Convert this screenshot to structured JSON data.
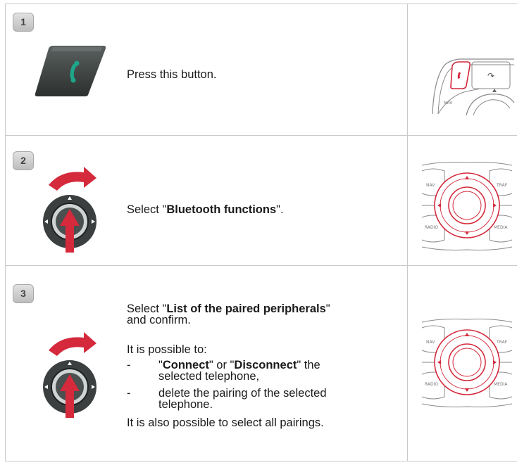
{
  "steps": [
    {
      "number": "1",
      "button_icon": "phone-handset-icon",
      "instruction": "Press this button.",
      "panel_labels": {
        "nav": "NAV"
      }
    },
    {
      "number": "2",
      "button_icon": "rotary-dial-icon",
      "instruction_prefix": "Select \"",
      "instruction_bold": "Bluetooth functions",
      "instruction_suffix": "\".",
      "panel_labels": {
        "nav": "NAV",
        "traf": "TRAF",
        "radio": "RADIO",
        "media": "MEDIA"
      }
    },
    {
      "number": "3",
      "button_icon": "rotary-dial-icon",
      "select_prefix": "Select \"",
      "select_bold": "List of the paired peripherals",
      "select_suffix": "\"",
      "select_line2": "and confirm.",
      "possible_intro": "It is possible to:",
      "bullets": [
        {
          "dash": "-",
          "q1": "\"",
          "bold1": "Connect",
          "mid": "\" or \"",
          "bold2": "Disconnect",
          "end": "\" the",
          "line2": "selected telephone,"
        },
        {
          "dash": "-",
          "line1": "delete the pairing of the selected",
          "line2": "telephone."
        }
      ],
      "also_possible": "It is also possible to select all pairings.",
      "panel_labels": {
        "nav": "NAV",
        "traf": "TRAF",
        "radio": "RADIO",
        "media": "MEDIA"
      }
    }
  ],
  "colors": {
    "accent_red": "#d42a3c",
    "grid_line": "#c9c9c9",
    "button_dark": "#3b3f3f",
    "phone_green": "#1fa58a"
  }
}
